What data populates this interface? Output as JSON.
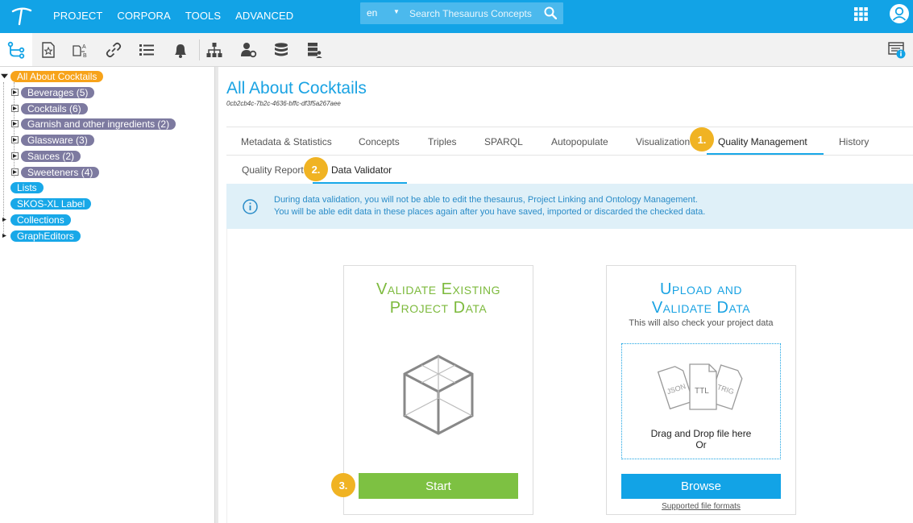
{
  "topbar": {
    "menu": [
      "PROJECT",
      "CORPORA",
      "TOOLS",
      "ADVANCED"
    ],
    "search": {
      "lang": "en",
      "placeholder": "Search Thesaurus Concepts"
    },
    "colors": {
      "bar": "#12a3e6"
    }
  },
  "toolbar": {
    "icons": [
      "hierarchy-icon",
      "starred-document-icon",
      "translate-labels-icon",
      "link-icon",
      "list-icon",
      "notifications-icon",
      "sitemap-icon",
      "user-settings-icon",
      "database-icon",
      "server-user-icon",
      "info-panel-icon"
    ]
  },
  "tree": {
    "root": "All About Cocktails",
    "children": [
      "Beverages (5)",
      "Cocktails (6)",
      "Garnish and other ingredients (2)",
      "Glassware (3)",
      "Sauces (2)",
      "Sweeteners (4)"
    ],
    "sections": [
      "Lists",
      "SKOS-XL Label",
      "Collections",
      "GraphEditors"
    ]
  },
  "main": {
    "title": "All About Cocktails",
    "uuid": "0cb2cb4c-7b2c-4636-bffc-df3f5a267aee",
    "tabs": [
      "Metadata & Statistics",
      "Concepts",
      "Triples",
      "SPARQL",
      "Autopopulate",
      "Visualization",
      "Quality Management",
      "History"
    ],
    "subtabs": [
      "Quality Report",
      "Data Validator"
    ],
    "badges": [
      "1.",
      "2.",
      "3."
    ],
    "info": {
      "line1": "During data validation, you will not be able to edit the thesaurus, Project Linking and Ontology Management.",
      "line2": "You will be able edit data in these places again after you have saved, imported or discarded the checked data."
    },
    "validate_card": {
      "title_line1": "Validate Existing",
      "title_line2": "Project Data",
      "button": "Start"
    },
    "upload_card": {
      "title_line1": "Upload and",
      "title_line2": "Validate Data",
      "subtitle": "This will also check your project data",
      "file_labels": [
        "JSON",
        "TTL",
        "TRIG"
      ],
      "drop_line1": "Drag and Drop file here",
      "drop_line2": "Or",
      "button": "Browse",
      "formats_link": "Supported file formats"
    }
  }
}
